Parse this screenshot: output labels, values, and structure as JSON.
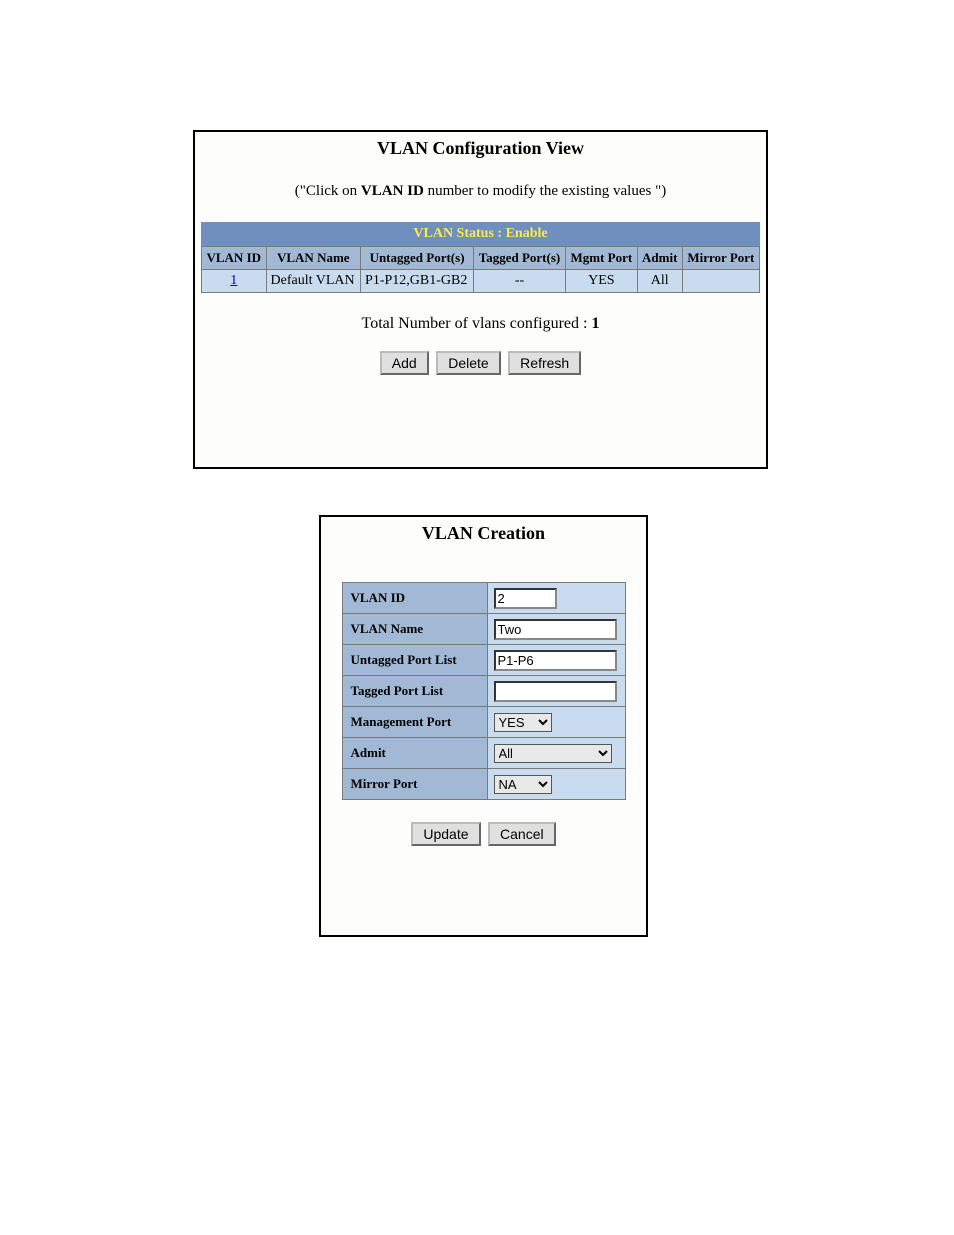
{
  "view": {
    "title": "VLAN Configuration View",
    "hint_prefix": "(\"Click on ",
    "hint_bold": "VLAN ID",
    "hint_suffix": " number to modify the existing values \")",
    "status_label": "VLAN Status   :   Enable",
    "headers": {
      "id": "VLAN ID",
      "name": "VLAN Name",
      "untagged": "Untagged Port(s)",
      "tagged": "Tagged Port(s)",
      "mgmt": "Mgmt Port",
      "admit": "Admit",
      "mirror": "Mirror Port"
    },
    "rows": [
      {
        "id": "1",
        "name": "Default VLAN",
        "untagged": "P1-P12,GB1-GB2",
        "tagged": "--",
        "mgmt": "YES",
        "admit": "All",
        "mirror": ""
      }
    ],
    "total_prefix": "Total Number of vlans configured : ",
    "total_value": "1",
    "buttons": {
      "add": "Add",
      "delete": "Delete",
      "refresh": "Refresh"
    }
  },
  "create": {
    "title": "VLAN Creation",
    "fields": {
      "vlan_id": {
        "label": "VLAN ID",
        "value": "2"
      },
      "vlan_name": {
        "label": "VLAN Name",
        "value": "Two"
      },
      "untagged": {
        "label": "Untagged Port List",
        "value": "P1-P6"
      },
      "tagged": {
        "label": "Tagged Port List",
        "value": ""
      },
      "mgmt": {
        "label": "Management Port",
        "value": "YES"
      },
      "admit": {
        "label": "Admit",
        "value": "All"
      },
      "mirror": {
        "label": "Mirror Port",
        "value": "NA"
      }
    },
    "buttons": {
      "update": "Update",
      "cancel": "Cancel"
    }
  }
}
